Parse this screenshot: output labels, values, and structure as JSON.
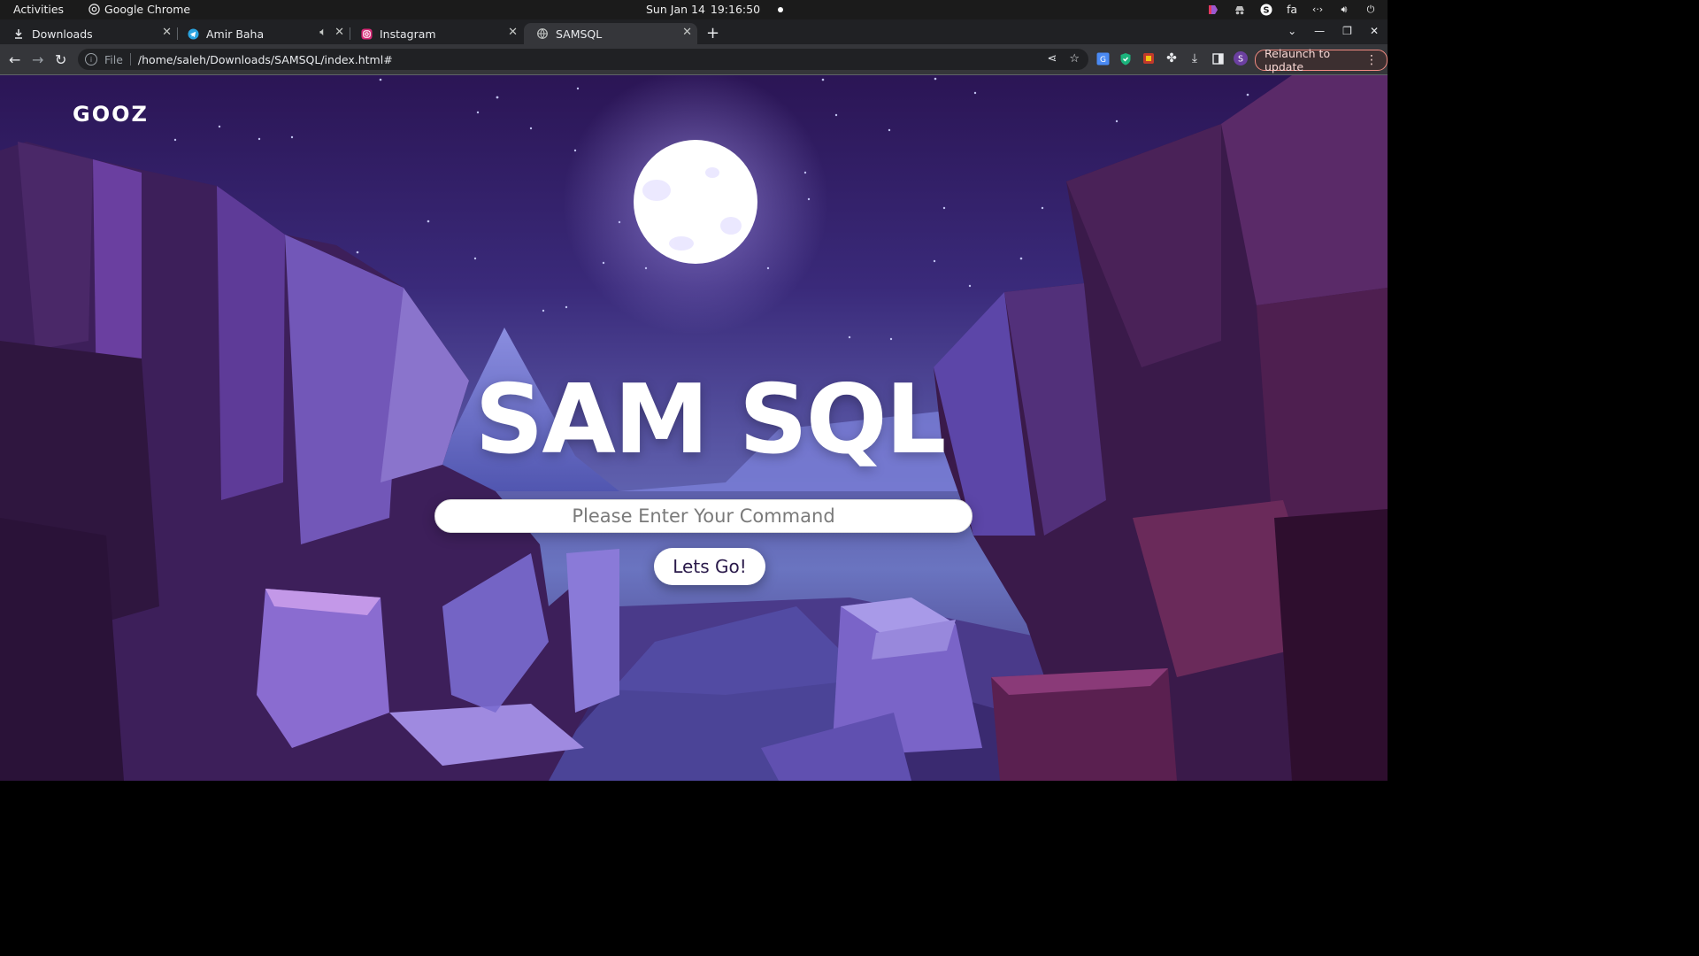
{
  "system": {
    "activities_label": "Activities",
    "app_name": "Google Chrome",
    "date": "Sun Jan 14",
    "time": "19:16:50",
    "keyboard_layout": "fa"
  },
  "browser": {
    "tabs": [
      {
        "label": "Downloads",
        "icon": "download-icon",
        "active": false
      },
      {
        "label": "Amir Baha",
        "icon": "telegram-icon",
        "active": false,
        "audio": true
      },
      {
        "label": "Instagram",
        "icon": "instagram-icon",
        "active": false
      },
      {
        "label": "SAMSQL",
        "icon": "globe-icon",
        "active": true
      }
    ],
    "address": {
      "scheme_label": "File",
      "url": "/home/saleh/Downloads/SAMSQL/index.html#"
    },
    "profile_initial": "S",
    "relaunch_label": "Relaunch to update"
  },
  "page": {
    "logo": "GOOZ",
    "title": "SAM SQL",
    "command_placeholder": "Please Enter Your Command",
    "command_value": "",
    "go_button_label": "Lets Go!"
  },
  "colors": {
    "sky_top": "#2b1555",
    "sky_bottom": "#6a74c0",
    "rock_dark": "#3a1d4a",
    "rock_light": "#7a62c8",
    "moon": "#ffffff",
    "relaunch_border": "#f28b82"
  }
}
